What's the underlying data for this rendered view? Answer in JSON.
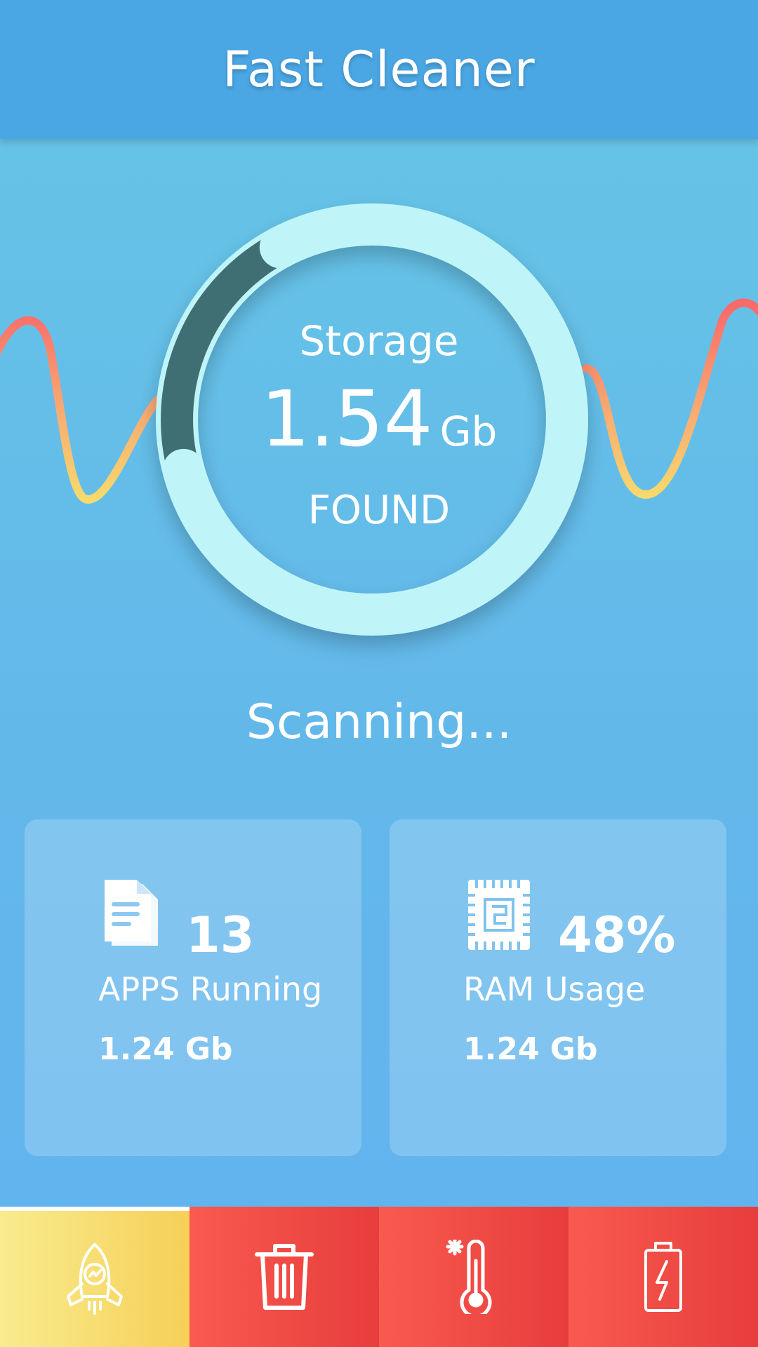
{
  "app": {
    "title": "Fast Cleaner"
  },
  "gauge": {
    "label": "Storage",
    "value": "1.54",
    "unit": "Gb",
    "status": "FOUND",
    "progress": 0.2
  },
  "scan": {
    "status_text": "Scanning..."
  },
  "cards": {
    "apps": {
      "icon": "document-icon",
      "value": "13",
      "label": "APPS Running",
      "size": "1.24 Gb"
    },
    "ram": {
      "icon": "chip-icon",
      "value": "48%",
      "label": "RAM Usage",
      "size": "1.24 Gb"
    }
  },
  "nav": {
    "tabs": [
      {
        "icon": "rocket-icon",
        "active": true
      },
      {
        "icon": "trash-icon",
        "active": false
      },
      {
        "icon": "thermometer-icon",
        "active": false
      },
      {
        "icon": "battery-icon",
        "active": false
      }
    ]
  },
  "colors": {
    "header": "#4aa7e4",
    "ring_track": "#bff5f8",
    "ring_progress": "#3f6f73",
    "wave_yellow": "#f7de6c",
    "wave_red": "#f96b6b",
    "nav_red": "#f05147",
    "nav_active": "#f7dd72"
  }
}
